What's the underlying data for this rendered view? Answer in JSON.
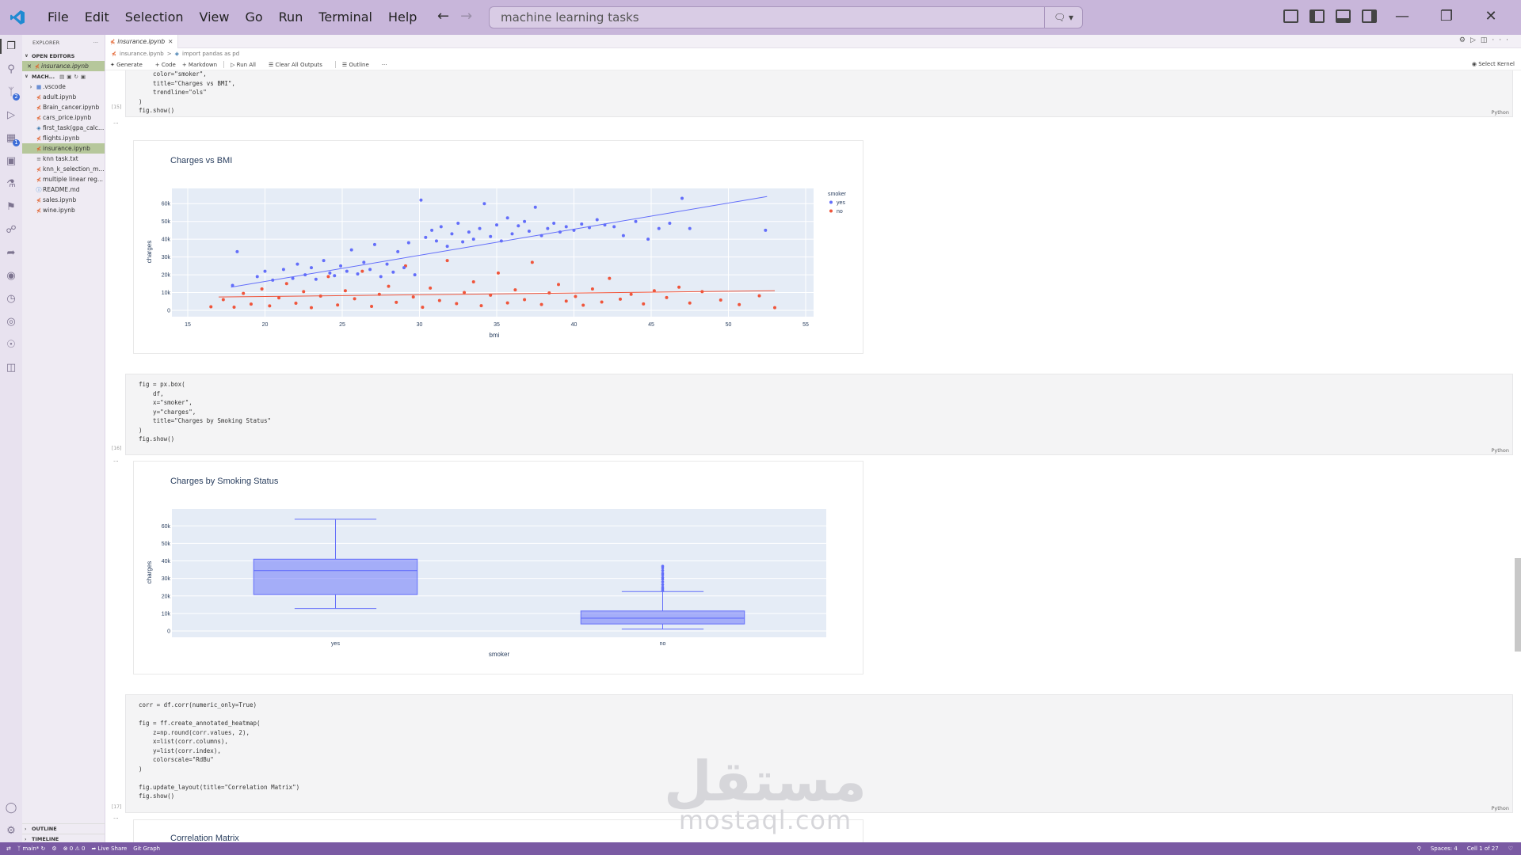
{
  "menu": [
    "File",
    "Edit",
    "Selection",
    "View",
    "Go",
    "Run",
    "Terminal",
    "Help"
  ],
  "search": {
    "text": "machine learning tasks"
  },
  "explorer": {
    "title": "EXPLORER",
    "open_editors_label": "OPEN EDITORS",
    "open_editor_file": "insurance.ipynb",
    "folder_label": "MACH...",
    "files": [
      {
        "name": ".vscode",
        "icon": "folder-icon"
      },
      {
        "name": "adult.ipynb",
        "icon": "notebook-icon"
      },
      {
        "name": "Brain_cancer.ipynb",
        "icon": "notebook-icon"
      },
      {
        "name": "cars_price.ipynb",
        "icon": "notebook-icon"
      },
      {
        "name": "first_task(gpa_calc)...",
        "icon": "python-icon"
      },
      {
        "name": "flights.ipynb",
        "icon": "notebook-icon"
      },
      {
        "name": "insurance.ipynb",
        "icon": "notebook-icon"
      },
      {
        "name": "knn task.txt",
        "icon": "text-icon"
      },
      {
        "name": "knn_k_selection_m...",
        "icon": "notebook-icon"
      },
      {
        "name": "multiple linear reg...",
        "icon": "notebook-icon"
      },
      {
        "name": "README.md",
        "icon": "info-icon"
      },
      {
        "name": "sales.ipynb",
        "icon": "notebook-icon"
      },
      {
        "name": "wine.ipynb",
        "icon": "notebook-icon"
      }
    ],
    "outline_label": "OUTLINE",
    "timeline_label": "TIMELINE"
  },
  "editor": {
    "tab": "insurance.ipynb",
    "breadcrumb": [
      "insurance.ipynb",
      ">",
      "import pandas as pd"
    ],
    "toolbar": [
      "Generate",
      "+ Code",
      "+ Markdown",
      "Run All",
      "Clear All Outputs",
      "Outline",
      "···"
    ],
    "kernel": "Select Kernel"
  },
  "cells": [
    {
      "exec": "[15]",
      "lang": "Python",
      "code": "    color=\"smoker\",\n    title=\"Charges vs BMI\",\n    trendline=\"ols\"\n)\nfig.show()"
    },
    {
      "exec": "[16]",
      "lang": "Python",
      "code": "fig = px.box(\n    df,\n    x=\"smoker\",\n    y=\"charges\",\n    title=\"Charges by Smoking Status\"\n)\nfig.show()"
    },
    {
      "exec": "[17]",
      "lang": "Python",
      "code": "corr = df.corr(numeric_only=True)\n\nfig = ff.create_annotated_heatmap(\n    z=np.round(corr.values, 2),\n    x=list(corr.columns),\n    y=list(corr.index),\n    colorscale=\"RdBu\"\n)\n\nfig.update_layout(title=\"Correlation Matrix\")\nfig.show()"
    }
  ],
  "chart_data": [
    {
      "type": "scatter",
      "title": "Charges vs BMI",
      "xlabel": "bmi",
      "ylabel": "charges",
      "xlim": [
        15,
        55
      ],
      "ylim": [
        0,
        65000
      ],
      "x_ticks": [
        "15",
        "20",
        "25",
        "30",
        "35",
        "40",
        "45",
        "50",
        "55"
      ],
      "y_ticks": [
        "0",
        "10k",
        "20k",
        "30k",
        "40k",
        "50k",
        "60k"
      ],
      "legend_title": "smoker",
      "legend_position": "top-right",
      "grid": true,
      "series": [
        {
          "name": "yes",
          "color": "#636efa",
          "trendline": [
            [
              17.8,
              13000
            ],
            [
              52.5,
              64000
            ]
          ],
          "points": [
            [
              17.9,
              14000
            ],
            [
              18.2,
              33000
            ],
            [
              19.5,
              19000
            ],
            [
              20.0,
              22000
            ],
            [
              20.5,
              17000
            ],
            [
              21.2,
              23000
            ],
            [
              21.8,
              18000
            ],
            [
              22.1,
              26000
            ],
            [
              22.6,
              20000
            ],
            [
              23.0,
              24000
            ],
            [
              23.3,
              17500
            ],
            [
              23.8,
              28000
            ],
            [
              24.2,
              21000
            ],
            [
              24.5,
              19500
            ],
            [
              24.9,
              25000
            ],
            [
              25.3,
              22000
            ],
            [
              25.6,
              34000
            ],
            [
              26.0,
              20500
            ],
            [
              26.4,
              27000
            ],
            [
              26.8,
              23000
            ],
            [
              27.1,
              37000
            ],
            [
              27.5,
              19000
            ],
            [
              27.9,
              26000
            ],
            [
              28.3,
              21500
            ],
            [
              28.6,
              33000
            ],
            [
              29.0,
              24000
            ],
            [
              29.3,
              38000
            ],
            [
              29.7,
              20000
            ],
            [
              30.1,
              62000
            ],
            [
              30.4,
              41000
            ],
            [
              30.8,
              45000
            ],
            [
              31.1,
              39000
            ],
            [
              31.4,
              47000
            ],
            [
              31.8,
              36000
            ],
            [
              32.1,
              43000
            ],
            [
              32.5,
              49000
            ],
            [
              32.8,
              38500
            ],
            [
              33.2,
              44000
            ],
            [
              33.5,
              40000
            ],
            [
              33.9,
              46000
            ],
            [
              34.2,
              60000
            ],
            [
              34.6,
              41500
            ],
            [
              35.0,
              48000
            ],
            [
              35.3,
              39000
            ],
            [
              35.7,
              52000
            ],
            [
              36.0,
              43000
            ],
            [
              36.4,
              47500
            ],
            [
              36.8,
              50000
            ],
            [
              37.1,
              44500
            ],
            [
              37.5,
              58000
            ],
            [
              37.9,
              42000
            ],
            [
              38.3,
              46000
            ],
            [
              38.7,
              49000
            ],
            [
              39.1,
              44000
            ],
            [
              39.5,
              47000
            ],
            [
              40.0,
              45000
            ],
            [
              40.5,
              48500
            ],
            [
              41.0,
              46500
            ],
            [
              41.5,
              51000
            ],
            [
              42.0,
              48000
            ],
            [
              42.6,
              47000
            ],
            [
              43.2,
              42000
            ],
            [
              44.0,
              50000
            ],
            [
              44.8,
              40000
            ],
            [
              45.5,
              46000
            ],
            [
              46.2,
              49000
            ],
            [
              47.0,
              63000
            ],
            [
              47.5,
              46000
            ],
            [
              52.4,
              45000
            ]
          ]
        },
        {
          "name": "no",
          "color": "#ef553b",
          "trendline": [
            [
              17.0,
              7500
            ],
            [
              53.0,
              11000
            ]
          ],
          "points": [
            [
              16.5,
              2000
            ],
            [
              17.3,
              6000
            ],
            [
              18.0,
              1800
            ],
            [
              18.6,
              9500
            ],
            [
              19.1,
              3500
            ],
            [
              19.8,
              12000
            ],
            [
              20.3,
              2500
            ],
            [
              20.9,
              7000
            ],
            [
              21.4,
              15000
            ],
            [
              22.0,
              4000
            ],
            [
              22.5,
              10500
            ],
            [
              23.0,
              1500
            ],
            [
              23.6,
              8000
            ],
            [
              24.1,
              19000
            ],
            [
              24.7,
              3000
            ],
            [
              25.2,
              11000
            ],
            [
              25.8,
              6500
            ],
            [
              26.3,
              22000
            ],
            [
              26.9,
              2200
            ],
            [
              27.4,
              9000
            ],
            [
              28.0,
              13500
            ],
            [
              28.5,
              4500
            ],
            [
              29.1,
              25000
            ],
            [
              29.6,
              7500
            ],
            [
              30.2,
              1700
            ],
            [
              30.7,
              12500
            ],
            [
              31.3,
              5500
            ],
            [
              31.8,
              28000
            ],
            [
              32.4,
              3800
            ],
            [
              32.9,
              10000
            ],
            [
              33.5,
              16000
            ],
            [
              34.0,
              2600
            ],
            [
              34.6,
              8500
            ],
            [
              35.1,
              21000
            ],
            [
              35.7,
              4200
            ],
            [
              36.2,
              11500
            ],
            [
              36.8,
              6000
            ],
            [
              37.3,
              27000
            ],
            [
              37.9,
              3300
            ],
            [
              38.4,
              9800
            ],
            [
              39.0,
              14500
            ],
            [
              39.5,
              5200
            ],
            [
              40.1,
              7800
            ],
            [
              40.6,
              2900
            ],
            [
              41.2,
              12000
            ],
            [
              41.8,
              4700
            ],
            [
              42.3,
              18000
            ],
            [
              43.0,
              6300
            ],
            [
              43.7,
              9000
            ],
            [
              44.5,
              3600
            ],
            [
              45.2,
              11000
            ],
            [
              46.0,
              7200
            ],
            [
              46.8,
              13000
            ],
            [
              47.5,
              4100
            ],
            [
              48.3,
              10500
            ],
            [
              49.5,
              5800
            ],
            [
              50.7,
              3200
            ],
            [
              52.0,
              8200
            ],
            [
              53.0,
              1500
            ]
          ]
        }
      ]
    },
    {
      "type": "box",
      "title": "Charges by Smoking Status",
      "xlabel": "smoker",
      "ylabel": "charges",
      "ylim": [
        0,
        66000
      ],
      "y_ticks": [
        "0",
        "10k",
        "20k",
        "30k",
        "40k",
        "50k",
        "60k"
      ],
      "grid": true,
      "categories": [
        "yes",
        "no"
      ],
      "color": "#636efa",
      "boxes": [
        {
          "category": "yes",
          "min": 12800,
          "q1": 20800,
          "median": 34500,
          "q3": 41000,
          "max": 63800,
          "outliers": []
        },
        {
          "category": "no",
          "min": 1100,
          "q1": 4000,
          "median": 7300,
          "q3": 11400,
          "max": 22500,
          "outliers": [
            23000,
            24000,
            25000,
            26500,
            28000,
            29500,
            30500,
            32000,
            33000,
            34500,
            36000,
            37000
          ]
        }
      ]
    }
  ],
  "chart3": {
    "title": "Correlation Matrix"
  },
  "status": {
    "branch": "main*",
    "errors": "0",
    "warnings": "0",
    "live_share": "Live Share",
    "git_graph": "Git Graph",
    "spaces": "Spaces: 4",
    "cell": "Cell 1 of 27"
  },
  "watermark": {
    "ar": "مستقل",
    "en": "mostaql.com"
  },
  "colors": {
    "titlebar": "#c8b6da",
    "statusbar": "#7a5aa3",
    "plot_bg": "#e5ecf6"
  }
}
